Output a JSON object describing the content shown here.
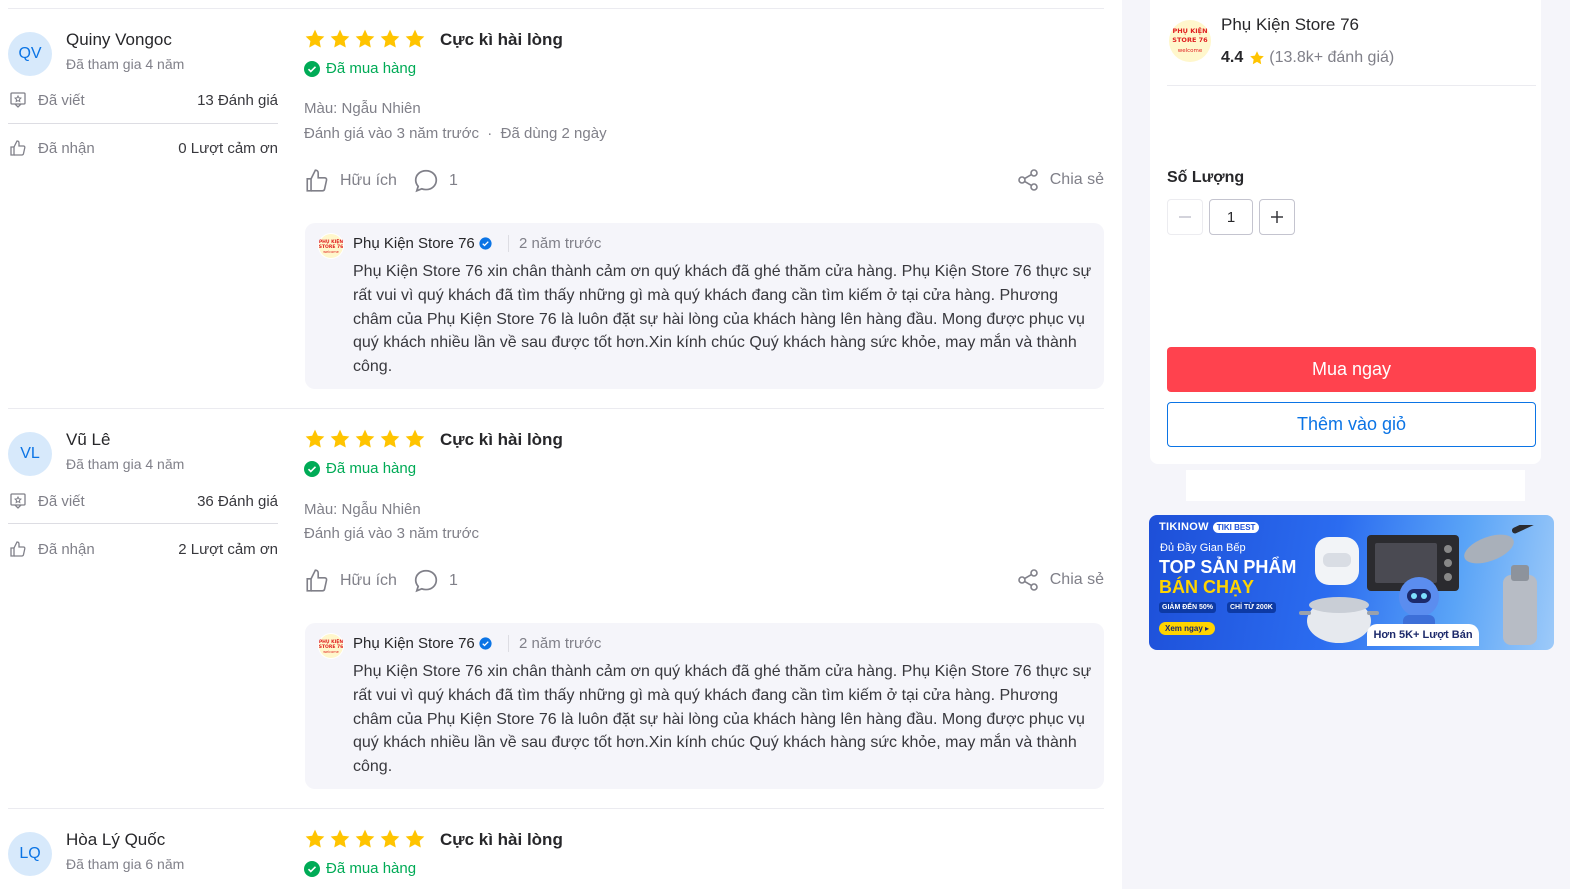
{
  "reviews": [
    {
      "initials": "QV",
      "name": "Quiny Vongoc",
      "joined": "Đã tham gia 4 năm",
      "written_label": "Đã viết",
      "written_value": "13 Đánh giá",
      "received_label": "Đã nhận",
      "received_value": "0 Lượt cảm ơn",
      "stars": 5,
      "title": "Cực kì hài lòng",
      "purchased": "Đã mua hàng",
      "variant": "Màu: Ngẫu Nhiên",
      "reviewed_at": "Đánh giá vào 3 năm trước",
      "used_for": "Đã dùng 2 ngày",
      "helpful_label": "Hữu ích",
      "comment_count": "1",
      "share_label": "Chia sẻ",
      "reply": {
        "shop": "Phụ Kiện Store 76",
        "time": "2 năm trước",
        "body": "Phụ Kiện Store 76 xin chân thành cảm ơn quý khách đã ghé thăm cửa hàng. Phụ Kiện Store 76 thực sự rất vui vì quý khách đã tìm thấy những gì mà quý khách đang cần tìm kiếm ở tại cửa hàng. Phương châm của Phụ Kiện Store 76 là luôn đặt sự hài lòng của khách hàng lên hàng đầu. Mong được phục vụ quý khách nhiều lần về sau được tốt hơn.Xin kính chúc Quý khách hàng sức khỏe, may mắn và thành công."
      }
    },
    {
      "initials": "VL",
      "name": "Vũ Lê",
      "joined": "Đã tham gia 4 năm",
      "written_label": "Đã viết",
      "written_value": "36 Đánh giá",
      "received_label": "Đã nhận",
      "received_value": "2 Lượt cảm ơn",
      "stars": 5,
      "title": "Cực kì hài lòng",
      "purchased": "Đã mua hàng",
      "variant": "Màu: Ngẫu Nhiên",
      "reviewed_at": "Đánh giá vào 3 năm trước",
      "helpful_label": "Hữu ích",
      "comment_count": "1",
      "share_label": "Chia sẻ",
      "reply": {
        "shop": "Phụ Kiện Store 76",
        "time": "2 năm trước",
        "body": "Phụ Kiện Store 76 xin chân thành cảm ơn quý khách đã ghé thăm cửa hàng. Phụ Kiện Store 76 thực sự rất vui vì quý khách đã tìm thấy những gì mà quý khách đang cần tìm kiếm ở tại cửa hàng. Phương châm của Phụ Kiện Store 76 là luôn đặt sự hài lòng của khách hàng lên hàng đầu. Mong được phục vụ quý khách nhiều lần về sau được tốt hơn.Xin kính chúc Quý khách hàng sức khỏe, may mắn và thành công."
      }
    },
    {
      "initials": "LQ",
      "name": "Hòa Lý Quốc",
      "joined": "Đã tham gia 6 năm",
      "stars": 5,
      "title": "Cực kì hài lòng",
      "purchased": "Đã mua hàng"
    }
  ],
  "seller": {
    "name": "Phụ Kiện Store 76",
    "rating": "4.4",
    "rating_count": "(13.8k+ đánh giá)",
    "logo_text": [
      "PHỤ KIỆN",
      "STORE 76",
      "welcome"
    ]
  },
  "purchase": {
    "quantity_label": "Số Lượng",
    "quantity_value": "1",
    "buy_now": "Mua ngay",
    "add_to_cart": "Thêm vào giỏ"
  },
  "banner": {
    "brand": "TIKINOW",
    "badge": "TIKI BEST",
    "subtitle": "Đủ Đầy Gian Bếp",
    "headline_1": "TOP SẢN PHẨM",
    "headline_2": "BÁN CHẠY",
    "tag_1": "GIẢM ĐẾN 50%",
    "tag_2": "CHỈ TỪ 200K",
    "cta": "Xem ngay",
    "sold": "Hơn 5K+ Lượt Bán"
  },
  "colors": {
    "star": "#ffc400",
    "purchased": "#00ab56",
    "buy_button": "#ff424e",
    "cart_button": "#0b74e5",
    "avatar_bg": "#d7e9fb"
  }
}
